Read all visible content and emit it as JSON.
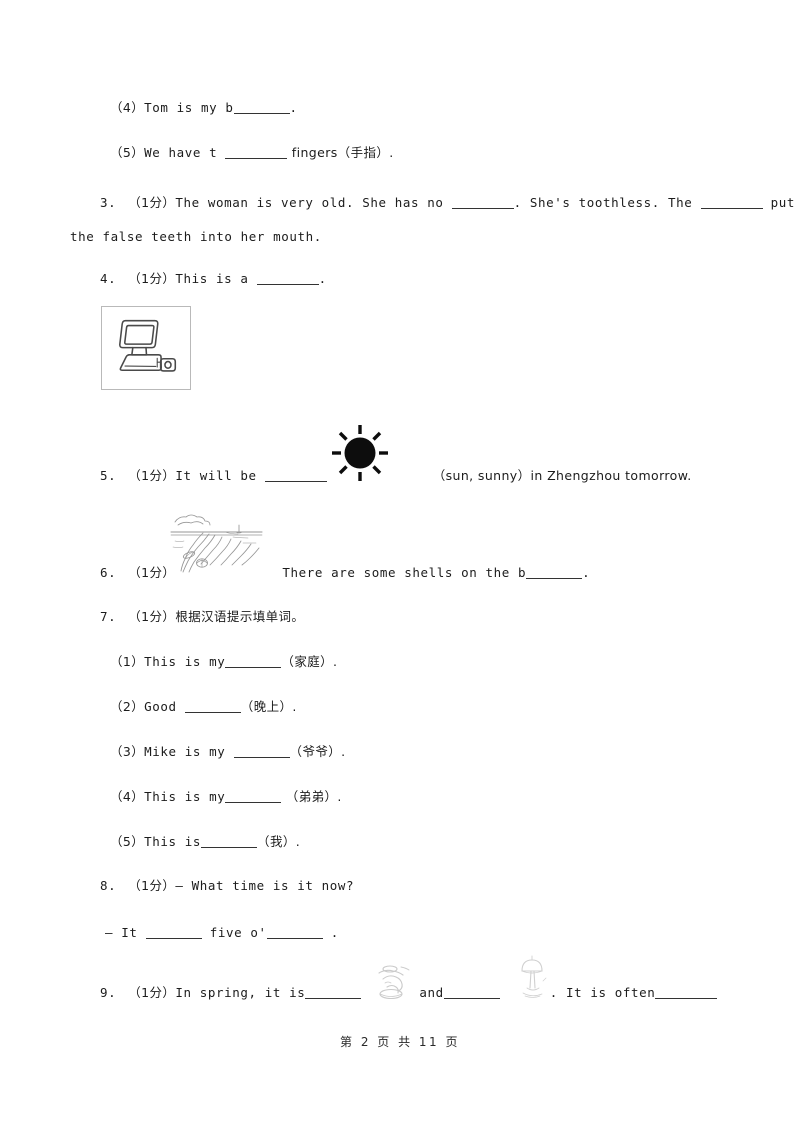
{
  "document": {
    "page_footer": "第 2 页 共 11 页",
    "page_number": "2",
    "total_pages": "11"
  },
  "items": {
    "q2_4": {
      "label": "（4）",
      "text_before": "Tom is my b",
      "text_after": "."
    },
    "q2_5": {
      "label": "（5）",
      "text_before": "We have t ",
      "text_after": " fingers（手指）."
    },
    "q3": {
      "number": "3.",
      "marks": "（1分）",
      "seg1": "The woman is very old. She has no ",
      "seg2": ". She's toothless. The ",
      "seg3": " put",
      "cont": "the false teeth into her mouth."
    },
    "q4": {
      "number": "4.",
      "marks": "（1分）",
      "seg1": "This is a ",
      "seg2": ".",
      "image_name": "computer-illustration"
    },
    "q5": {
      "number": "5.",
      "marks": "（1分）",
      "seg1": "It will be ",
      "seg2": "（sun, sunny）in Zhengzhou tomorrow.",
      "image_name": "sun-illustration"
    },
    "q6": {
      "number": "6.",
      "marks": "（1分）",
      "seg1": "There are some shells on the b",
      "seg2": ".",
      "image_name": "beach-shells-illustration"
    },
    "q7": {
      "number": "7.",
      "marks": "（1分）",
      "prompt": "根据汉语提示填单词。",
      "sub": [
        {
          "label": "（1）",
          "before": "This is my",
          "after": "（家庭）."
        },
        {
          "label": "（2）",
          "before": "Good ",
          "after": "（晚上）."
        },
        {
          "label": "（3）",
          "before": "Mike is my ",
          "after": "（爷爷）."
        },
        {
          "label": "（4）",
          "before": "This is my",
          "after": " （弟弟）."
        },
        {
          "label": "（5）",
          "before": "This is",
          "after": "（我）."
        }
      ]
    },
    "q8": {
      "number": "8.",
      "marks": "（1分）",
      "question": "— What time is it now?",
      "answer_before": "— It ",
      "answer_mid": " five o'",
      "answer_after": " ."
    },
    "q9": {
      "number": "9.",
      "marks": "（1分）",
      "seg1": "In spring, it is",
      "seg2": "and",
      "seg3": ". It is often",
      "image1_name": "faint-sketch-a",
      "image2_name": "faint-sketch-b"
    }
  },
  "colors": {
    "text": "#1c1c1c",
    "rule": "#333333",
    "image_border": "#b9b9b9",
    "background": "#ffffff"
  }
}
